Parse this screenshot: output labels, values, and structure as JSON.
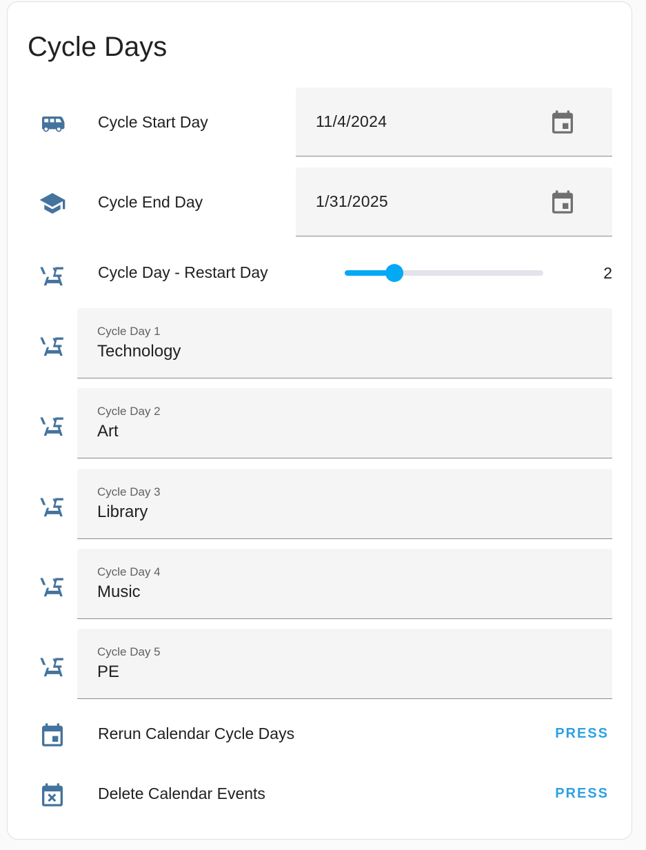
{
  "card": {
    "title": "Cycle Days"
  },
  "rows": {
    "start": {
      "label": "Cycle Start Day",
      "value": "11/4/2024",
      "icon": "bus-icon"
    },
    "end": {
      "label": "Cycle End Day",
      "value": "1/31/2025",
      "icon": "graduation-cap-icon"
    },
    "restart": {
      "label": "Cycle Day - Restart Day",
      "value": "2",
      "fraction": 0.25,
      "icon": "school-desk-icon"
    },
    "days": [
      {
        "label": "Cycle Day 1",
        "value": "Technology"
      },
      {
        "label": "Cycle Day 2",
        "value": "Art"
      },
      {
        "label": "Cycle Day 3",
        "value": "Library"
      },
      {
        "label": "Cycle Day 4",
        "value": "Music"
      },
      {
        "label": "Cycle Day 5",
        "value": "PE"
      }
    ],
    "rerun": {
      "label": "Rerun Calendar Cycle Days",
      "action": "PRESS",
      "icon": "calendar-icon"
    },
    "delete": {
      "label": "Delete Calendar Events",
      "action": "PRESS",
      "icon": "calendar-remove-icon"
    }
  },
  "colors": {
    "icon": "#44739e",
    "accent": "#03a9f4",
    "press": "#2fa0e0"
  }
}
